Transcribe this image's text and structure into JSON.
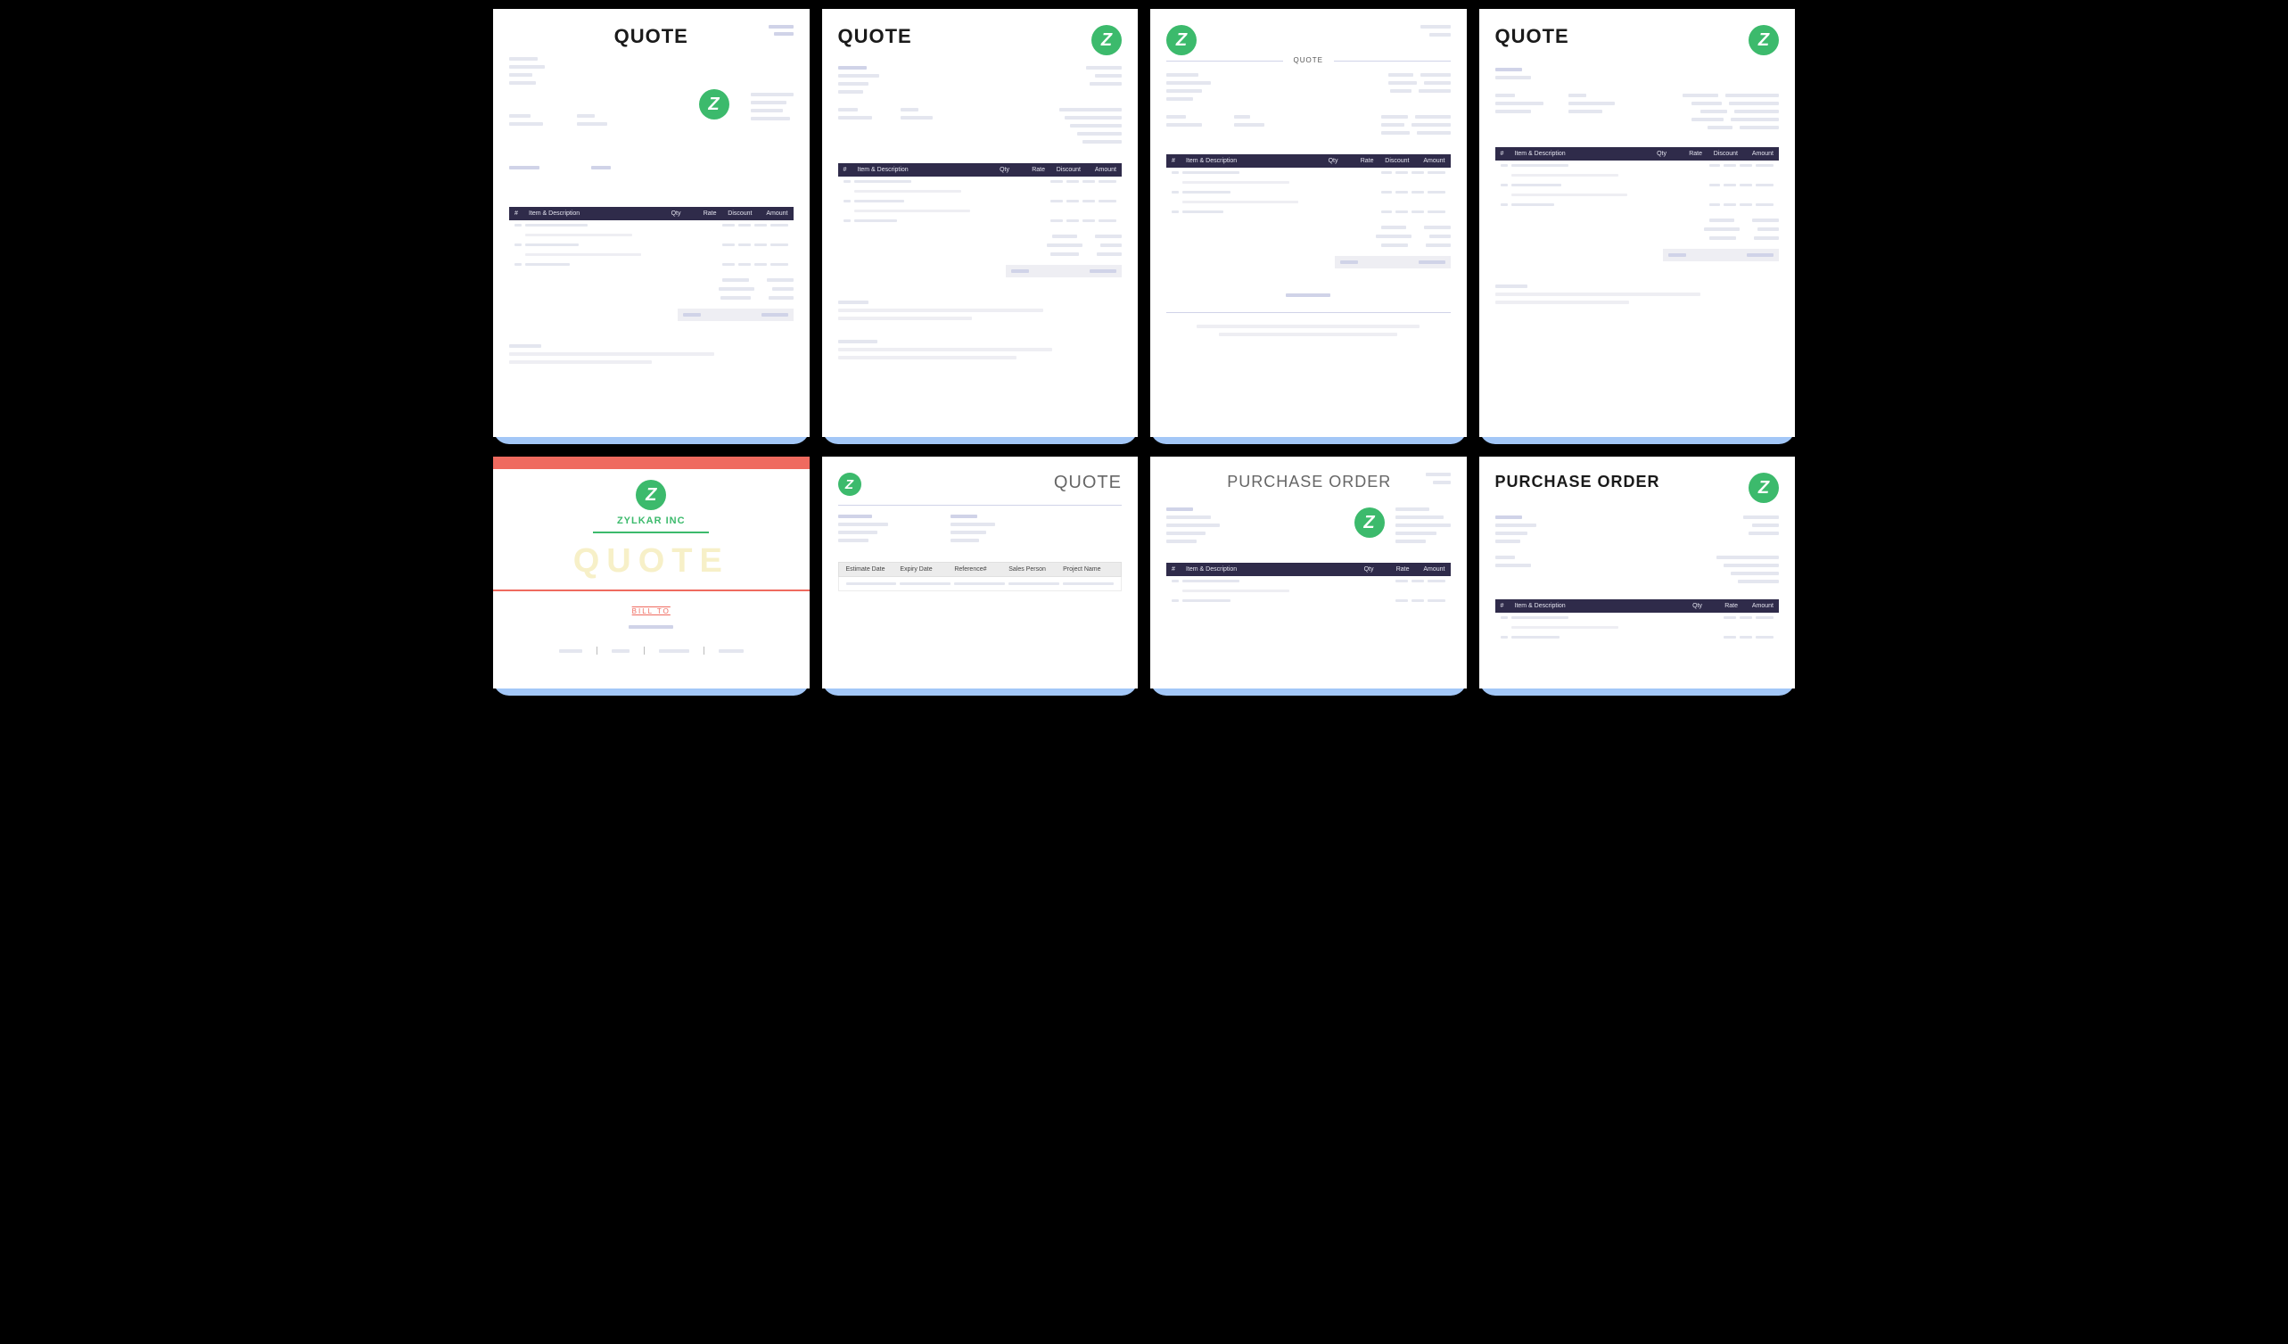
{
  "titles": {
    "quote": "QUOTE",
    "purchase_order": "PURCHASE ORDER"
  },
  "logo_letter": "Z",
  "company_name": "ZYLKAR INC",
  "bill_to": "BILL TO",
  "table": {
    "cols_full": {
      "num": "#",
      "item": "Item & Description",
      "qty": "Qty",
      "rate": "Rate",
      "discount": "Discount",
      "amount": "Amount"
    },
    "cols_po": {
      "num": "#",
      "item": "Item & Description",
      "qty": "Qty",
      "rate": "Rate",
      "amount": "Amount"
    }
  },
  "quote_meta_cols": {
    "estimate_date": "Estimate Date",
    "expiry_date": "Expiry Date",
    "reference": "Reference#",
    "sales_person": "Sales Person",
    "project_name": "Project Name"
  }
}
